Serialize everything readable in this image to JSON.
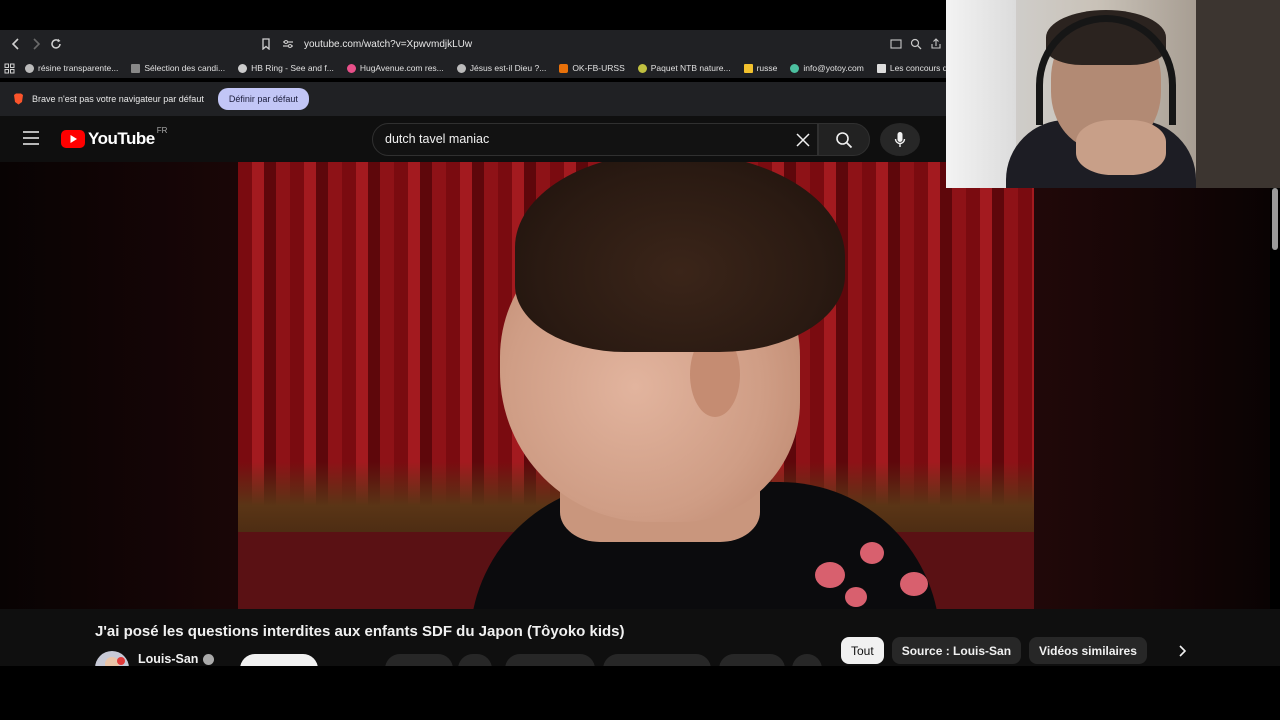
{
  "browser": {
    "url": "youtube.com/watch?v=XpwvmdjkLUw",
    "bookmarks": [
      {
        "label": "résine transparente...",
        "color": "#bbbbbb"
      },
      {
        "label": "Sélection des candi...",
        "color": "#888888"
      },
      {
        "label": "HB Ring - See and f...",
        "color": "#cccccc"
      },
      {
        "label": "HugAvenue.com res...",
        "color": "#e9508a"
      },
      {
        "label": "Jésus est-il Dieu ?...",
        "color": "#bbbbbb"
      },
      {
        "label": "OK-FB-URSS",
        "color": "#e8710a"
      },
      {
        "label": "Paquet NTB nature...",
        "color": "#c0c040"
      },
      {
        "label": "russe",
        "color": "#f2c12e"
      },
      {
        "label": "info@yotoy.com",
        "color": "#4cc0a0"
      },
      {
        "label": "Les concours d'aute...",
        "color": "#dddddd"
      }
    ],
    "notice_text": "Brave n'est pas votre navigateur par défaut",
    "set_default_label": "Définir par défaut"
  },
  "youtube": {
    "logo_text": "YouTube",
    "region": "FR",
    "search_value": "dutch tavel maniac"
  },
  "video": {
    "title": "J'ai posé les questions interdites aux enfants SDF du Japon (Tôyoko kids)",
    "channel": "Louis-San"
  },
  "chips": {
    "all": "Tout",
    "source": "Source : Louis-San",
    "similar": "Vidéos similaires"
  },
  "colors": {
    "brand_red": "#ff0000",
    "chip_active_bg": "#f1f1f1",
    "chip_bg": "#272727",
    "default_button": "#c2c6f6"
  }
}
